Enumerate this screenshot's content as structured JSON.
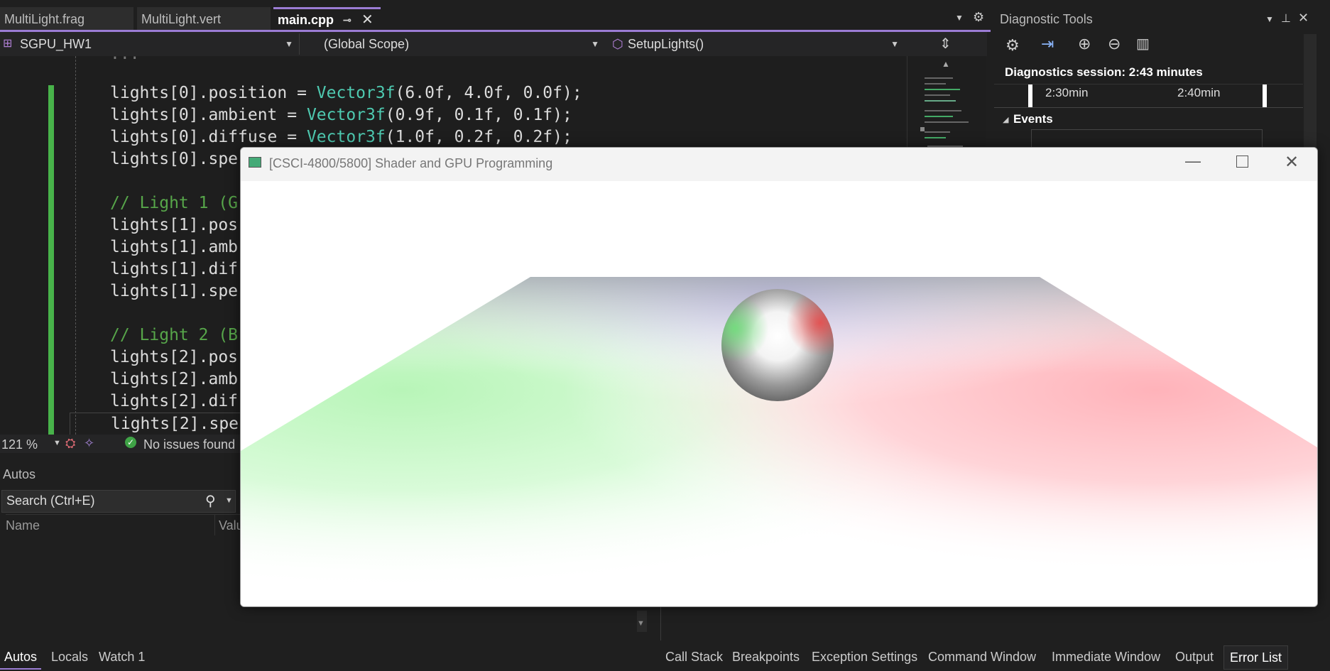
{
  "tabs": [
    {
      "label": "MultiLight.frag"
    },
    {
      "label": "MultiLight.vert"
    },
    {
      "label": "main.cpp"
    }
  ],
  "navbar": {
    "project": "SGPU_HW1",
    "scope": "(Global Scope)",
    "function": "SetupLights()"
  },
  "code": {
    "partial_top": "... ",
    "line1": "lights[0].position = ",
    "line1_call": "Vector3f",
    "line1_args": "(6.0f, 4.0f, 0.0f);",
    "line2": "lights[0].ambient = ",
    "line2_call": "Vector3f",
    "line2_args": "(0.9f, 0.1f, 0.1f);",
    "line3": "lights[0].diffuse = ",
    "line3_call": "Vector3f",
    "line3_args": "(1.0f, 0.2f, 0.2f);",
    "line4": "lights[0].spe",
    "line5": "// Light 1 (G",
    "line6": "lights[1].pos",
    "line7": "lights[1].amb",
    "line8": "lights[1].dif",
    "line9": "lights[1].spe",
    "line10": "// Light 2 (B",
    "line11": "lights[2].pos",
    "line12": "lights[2].amb",
    "line13": "lights[2].dif",
    "line14": "lights[2].spe"
  },
  "status": {
    "zoom": "121 %",
    "issues": "No issues found"
  },
  "autos": {
    "title": "Autos",
    "search_placeholder": "Search (Ctrl+E)",
    "col_name": "Name",
    "col_value": "Valu"
  },
  "bottom_tabs_left": [
    "Autos",
    "Locals",
    "Watch 1"
  ],
  "bottom_tabs_right": [
    "Call Stack",
    "Breakpoints",
    "Exception Settings",
    "Command Window",
    "Immediate Window",
    "Output",
    "Error List"
  ],
  "diagnostics": {
    "title": "Diagnostic Tools",
    "session": "Diagnostics session: 2:43 minutes",
    "tick1": "2:30min",
    "tick2": "2:40min",
    "events": "Events"
  },
  "window": {
    "title": "[CSCI-4800/5800] Shader and GPU Programming"
  },
  "colors": {
    "accent": "#9b7cd4",
    "change_bar": "#48b34a",
    "comment": "#57a64a",
    "type": "#4ec9b0"
  }
}
